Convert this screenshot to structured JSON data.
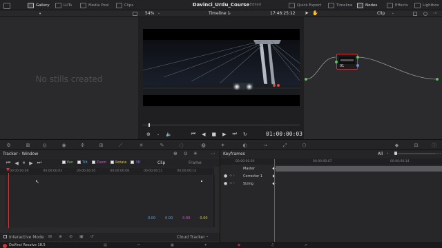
{
  "toolbar": {
    "gallery": "Gallery",
    "luts": "LUTs",
    "media_pool": "Media Pool",
    "clips": "Clips",
    "project_title": "Davinci_Urdu_Course",
    "edited": "Edited",
    "quick_export": "Quick Export",
    "timeline": "Timeline",
    "nodes": "Nodes",
    "effects": "Effects",
    "lightbox": "Lightbox"
  },
  "subbar": {
    "zoom": "54%",
    "timeline_name": "Timeline 1",
    "source_timecode": "17:46:25:12",
    "clip_mode": "Clip"
  },
  "gallery": {
    "empty_text": "No stills created"
  },
  "viewer": {
    "timecode": "01:00:00:03",
    "playhead_fraction": 0.04
  },
  "nodes": {
    "node_label": "01"
  },
  "tracker": {
    "title": "Tracker - Window",
    "options": [
      {
        "label": "Pan",
        "color": "#6fc46f",
        "checked": true
      },
      {
        "label": "Tilt",
        "color": "#5fa8e0",
        "checked": true
      },
      {
        "label": "Zoom",
        "color": "#d05ad0",
        "checked": true
      },
      {
        "label": "Rotate",
        "color": "#d8c84a",
        "checked": true
      },
      {
        "label": "3D",
        "color": "#7a7ad8",
        "checked": true
      }
    ],
    "clip_label": "Clip",
    "frame_label": "Frame",
    "ruler": [
      "00:00:00:00",
      "00:00:00:03",
      "00:00:00:05",
      "00:00:00:08",
      "00:00:00:11",
      "00:00:00:13"
    ],
    "values": [
      {
        "value": "0.00",
        "color": "#5fa8e0"
      },
      {
        "value": "0.00",
        "color": "#5fa8e0"
      },
      {
        "value": "0.00",
        "color": "#d05ad0"
      },
      {
        "value": "0.00",
        "color": "#d8c84a"
      }
    ],
    "interactive_mode": "Interactive Mode",
    "cloud_tracker": "Cloud Tracker"
  },
  "keyframes": {
    "title": "Keyframes",
    "filter": "All",
    "ruler": [
      "00:00:00:00",
      "00:00:00:07",
      "00:00:00:14"
    ],
    "rows": [
      "Master",
      "Corrector 1",
      "Sizing"
    ]
  },
  "status": {
    "app": "DaVinci Resolve 18.5"
  },
  "colors": {
    "accent": "#c83a3a",
    "node_dot_green": "#5cc45c",
    "node_dot_yellow": "#d8c84a"
  }
}
